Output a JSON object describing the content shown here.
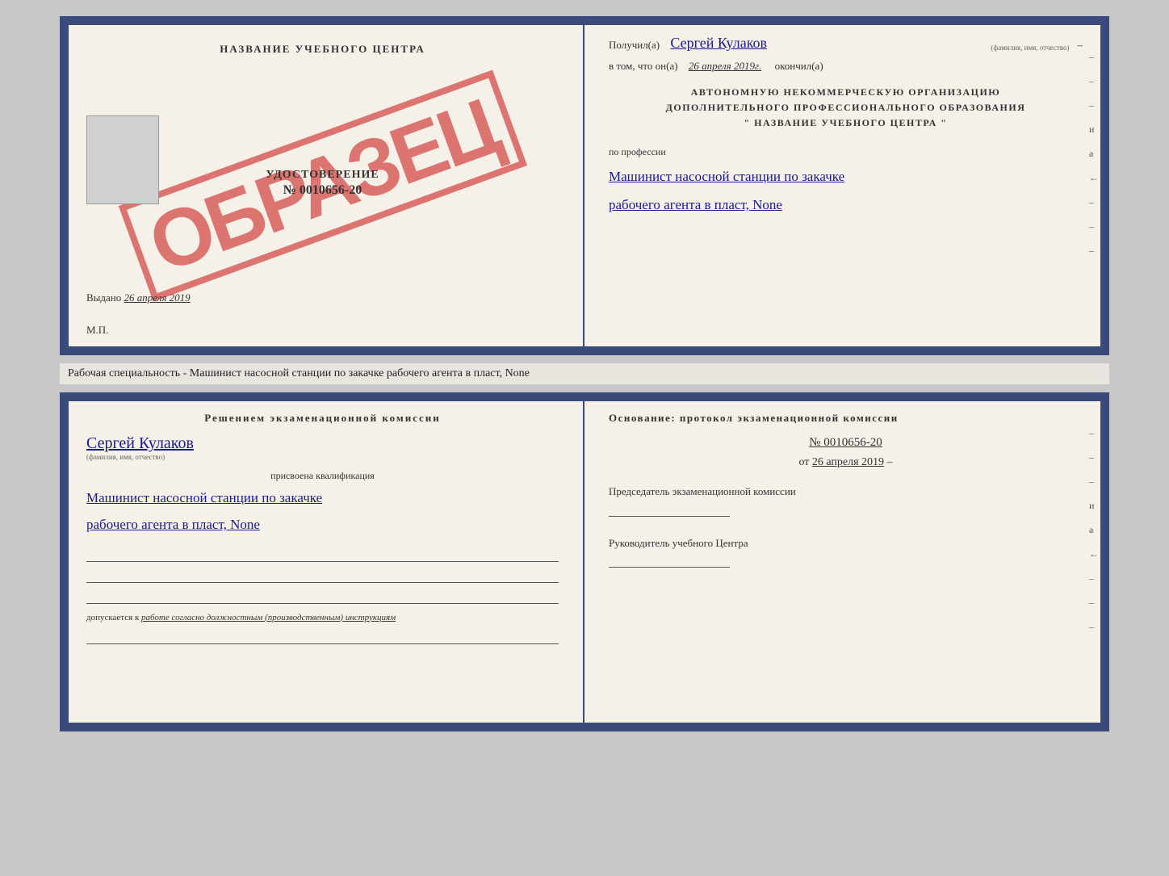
{
  "top": {
    "left": {
      "center_title": "НАЗВАНИЕ УЧЕБНОГО ЦЕНТРА",
      "sample_stamp": "ОБРАЗЕЦ",
      "certificate_label": "УДОСТОВЕРЕНИЕ",
      "certificate_number": "№ 0010656-20",
      "issued_prefix": "Выдано",
      "issued_date": "26 апреля 2019",
      "mp_label": "М.П."
    },
    "right": {
      "received_prefix": "Получил(а)",
      "received_name": "Сергей Кулаков",
      "name_hint": "(фамилия, имя, отчество)",
      "date_prefix": "в том, что он(а)",
      "date_value": "26 апреля 2019г.",
      "finished_label": "окончил(а)",
      "org_line1": "АВТОНОМНУЮ НЕКОММЕРЧЕСКУЮ ОРГАНИЗАЦИЮ",
      "org_line2": "ДОПОЛНИТЕЛЬНОГО ПРОФЕССИОНАЛЬНОГО ОБРАЗОВАНИЯ",
      "org_line3": "\"  НАЗВАНИЕ УЧЕБНОГО ЦЕНТРА  \"",
      "profession_label": "по профессии",
      "profession_line1": "Машинист насосной станции по закачке",
      "profession_line2": "рабочего агента в пласт, None",
      "dashes": [
        "-",
        "-",
        "-",
        "и",
        "а",
        "←",
        "-",
        "-",
        "-"
      ]
    }
  },
  "middle_text": "Рабочая специальность - Машинист насосной станции по закачке рабочего агента в пласт,\nNone",
  "bottom": {
    "left": {
      "commission_title": "Решением  экзаменационной  комиссии",
      "person_name": "Сергей Кулаков",
      "name_hint": "(фамилия, имя, отчество)",
      "assigned_label": "присвоена квалификация",
      "qualification_line1": "Машинист насосной станции по закачке",
      "qualification_line2": "рабочего агента в пласт, None",
      "allowed_prefix": "допускается к",
      "allowed_text": "работе согласно должностным (производственным) инструкциям"
    },
    "right": {
      "basis_title": "Основание: протокол экзаменационной комиссии",
      "protocol_number": "№  0010656-20",
      "protocol_date_prefix": "от",
      "protocol_date": "26 апреля 2019",
      "chairman_title": "Председатель экзаменационной комиссии",
      "head_title": "Руководитель учебного Центра",
      "dashes": [
        "-",
        "-",
        "-",
        "и",
        "а",
        "←",
        "-",
        "-",
        "-"
      ]
    }
  }
}
